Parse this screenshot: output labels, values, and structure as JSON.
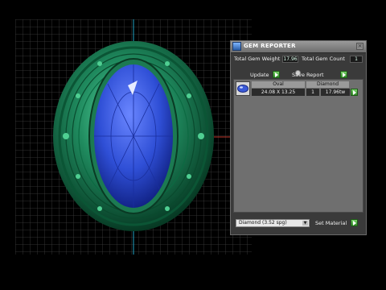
{
  "panel": {
    "title": "GEM REPORTER",
    "close_glyph": "×",
    "total_gem_weight_label": "Total Gem Weight",
    "total_gem_weight_value": "17.96",
    "total_gem_count_label": "Total Gem Count",
    "total_gem_count_value": "1",
    "update_label": "Update",
    "save_report_label": "Save Report",
    "table": {
      "columns": [
        "Oval",
        "Diamond"
      ],
      "rows": [
        {
          "size": "24.08 X 13.25",
          "count": "1",
          "weight": "17.96tw"
        }
      ]
    },
    "material_select_value": "Diamond   (3.52 spg)",
    "set_material_label": "Set Material"
  },
  "icons": [
    "app-icon",
    "close-icon",
    "play-icon",
    "gem-thumbnail-icon"
  ],
  "colors": {
    "metal": "#1f8a5e",
    "stone": "#2f4fd6",
    "grid": "#4a4a4a",
    "panel_bg": "#3a3a3a"
  }
}
